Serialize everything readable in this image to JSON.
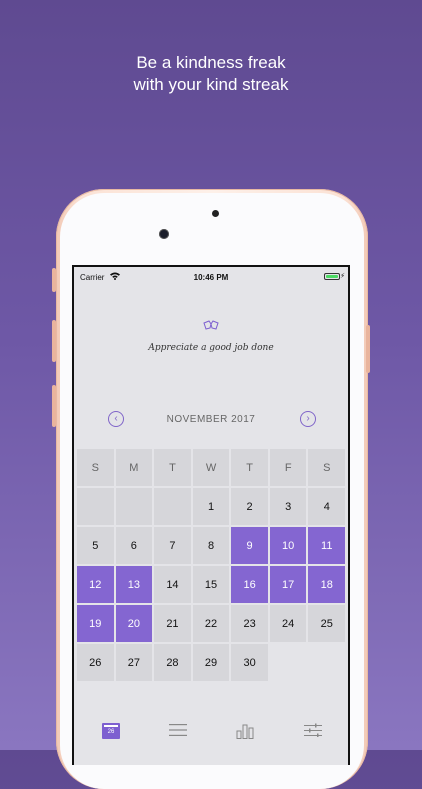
{
  "headline": {
    "line1": "Be a kindness freak",
    "line2": "with your kind streak"
  },
  "statusbar": {
    "carrier": "Carrier",
    "time": "10:46 PM"
  },
  "quote": "Appreciate a good job done",
  "calendar": {
    "month": "NOVEMBER 2017",
    "weekdays": [
      "S",
      "M",
      "T",
      "W",
      "T",
      "F",
      "S"
    ],
    "weeks": [
      [
        "",
        "",
        "",
        "1",
        "2",
        "3",
        "4"
      ],
      [
        "5",
        "6",
        "7",
        "8",
        "9",
        "10",
        "11"
      ],
      [
        "12",
        "13",
        "14",
        "15",
        "16",
        "17",
        "18"
      ],
      [
        "19",
        "20",
        "21",
        "22",
        "23",
        "24",
        "25"
      ],
      [
        "26",
        "27",
        "28",
        "29",
        "30",
        "",
        ""
      ]
    ],
    "highlighted_days": [
      "9",
      "10",
      "11",
      "12",
      "13",
      "16",
      "17",
      "18",
      "19",
      "20"
    ]
  },
  "tabbar": {
    "calendar_day": "26"
  },
  "colors": {
    "accent": "#8466d1",
    "background_top": "#5f4a91",
    "background_bottom": "#8a76c0"
  }
}
